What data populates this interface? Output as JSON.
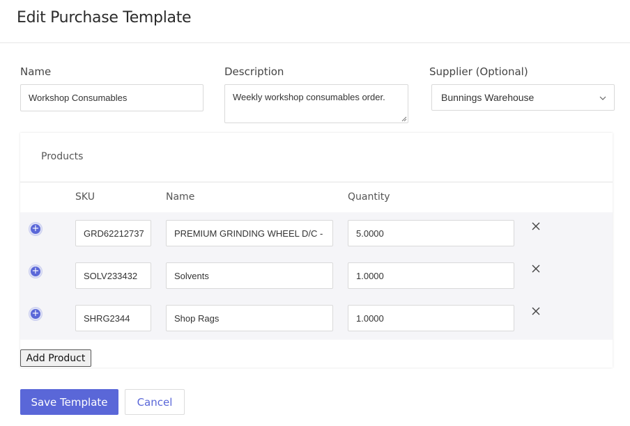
{
  "page_title": "Edit Purchase Template",
  "form": {
    "name": {
      "label": "Name",
      "value": "Workshop Consumables"
    },
    "description": {
      "label": "Description",
      "value": "Weekly workshop consumables order."
    },
    "supplier": {
      "label": "Supplier (Optional)",
      "value": "Bunnings Warehouse"
    }
  },
  "products": {
    "title": "Products",
    "columns": {
      "sku": "SKU",
      "name": "Name",
      "quantity": "Quantity"
    },
    "rows": [
      {
        "sku": "GRD62212737",
        "name": "PREMIUM GRINDING WHEEL D/C -",
        "quantity": "5.0000"
      },
      {
        "sku": "SOLV233432",
        "name": "Solvents",
        "quantity": "1.0000"
      },
      {
        "sku": "SHRG2344",
        "name": "Shop Rags",
        "quantity": "1.0000"
      }
    ],
    "add_label": "Add Product"
  },
  "actions": {
    "save_label": "Save Template",
    "cancel_label": "Cancel"
  },
  "icons": {
    "expand": "plus-circle-icon",
    "remove": "close-icon",
    "dropdown": "chevron-down-icon"
  },
  "colors": {
    "accent": "#5a67d8",
    "row_bg": "#f5f5f8"
  }
}
